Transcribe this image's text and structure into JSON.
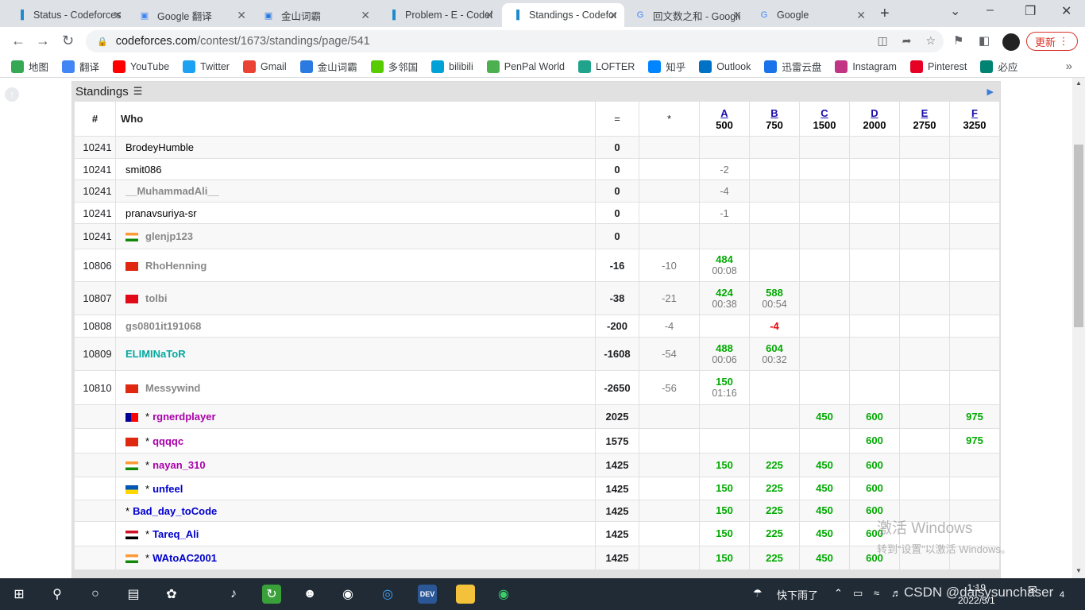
{
  "browser": {
    "tabs": [
      {
        "title": "Status - Codeforces",
        "icon": "codeforces-icon",
        "active": false
      },
      {
        "title": "Google 翻译",
        "icon": "google-translate-icon",
        "active": false
      },
      {
        "title": "金山词霸",
        "icon": "iciba-icon",
        "active": false
      },
      {
        "title": "Problem - E - Codeforces",
        "icon": "codeforces-icon",
        "active": false
      },
      {
        "title": "Standings - Codeforces",
        "icon": "codeforces-icon",
        "active": true
      },
      {
        "title": "回文数之和 - Google",
        "icon": "google-icon",
        "active": false
      },
      {
        "title": "Google",
        "icon": "google-icon",
        "active": false
      }
    ],
    "url_host": "codeforces.com",
    "url_path": "/contest/1673/standings/page/541",
    "update_label": "更新",
    "bookmarks": [
      {
        "label": "地图",
        "icon": "maps-icon",
        "color": "#34a853"
      },
      {
        "label": "翻译",
        "icon": "translate-icon",
        "color": "#4285f4"
      },
      {
        "label": "YouTube",
        "icon": "youtube-icon",
        "color": "#ff0000"
      },
      {
        "label": "Twitter",
        "icon": "twitter-icon",
        "color": "#1da1f2"
      },
      {
        "label": "Gmail",
        "icon": "gmail-icon",
        "color": "#ea4335"
      },
      {
        "label": "金山词霸",
        "icon": "iciba-icon",
        "color": "#2a7ae2"
      },
      {
        "label": "多邻国",
        "icon": "duolingo-icon",
        "color": "#58cc02"
      },
      {
        "label": "bilibili",
        "icon": "bilibili-icon",
        "color": "#00a1d6"
      },
      {
        "label": "PenPal World",
        "icon": "penpal-icon",
        "color": "#4caf50"
      },
      {
        "label": "LOFTER",
        "icon": "lofter-icon",
        "color": "#1fa38b"
      },
      {
        "label": "知乎",
        "icon": "zhihu-icon",
        "color": "#0084ff"
      },
      {
        "label": "Outlook",
        "icon": "outlook-icon",
        "color": "#0072c6"
      },
      {
        "label": "迅雷云盘",
        "icon": "xunlei-icon",
        "color": "#1a73e8"
      },
      {
        "label": "Instagram",
        "icon": "instagram-icon",
        "color": "#c13584"
      },
      {
        "label": "Pinterest",
        "icon": "pinterest-icon",
        "color": "#e60023"
      },
      {
        "label": "必应",
        "icon": "bing-icon",
        "color": "#008373"
      }
    ]
  },
  "standings": {
    "title": "Standings",
    "columns": {
      "rank": "#",
      "who": "Who",
      "score": "=",
      "penalty": "*",
      "problems": [
        {
          "letter": "A",
          "points": "500"
        },
        {
          "letter": "B",
          "points": "750"
        },
        {
          "letter": "C",
          "points": "1500"
        },
        {
          "letter": "D",
          "points": "2000"
        },
        {
          "letter": "E",
          "points": "2750"
        },
        {
          "letter": "F",
          "points": "3250"
        }
      ]
    },
    "rows": [
      {
        "rank": "10241",
        "flag": "",
        "star": "",
        "handle": "BrodeyHumble",
        "color": "black",
        "score": "0",
        "penalty": "",
        "cells": [
          [
            "",
            ""
          ],
          [
            "",
            ""
          ],
          [
            "",
            ""
          ],
          [
            "",
            ""
          ],
          [
            "",
            ""
          ],
          [
            "",
            ""
          ]
        ]
      },
      {
        "rank": "10241",
        "flag": "",
        "star": "",
        "handle": "smit086",
        "color": "black",
        "score": "0",
        "penalty": "",
        "cells": [
          [
            "-2",
            ""
          ],
          [
            "",
            ""
          ],
          [
            "",
            ""
          ],
          [
            "",
            ""
          ],
          [
            "",
            ""
          ],
          [
            "",
            ""
          ]
        ]
      },
      {
        "rank": "10241",
        "flag": "",
        "star": "",
        "handle": "__MuhammadAli__",
        "color": "gray",
        "score": "0",
        "penalty": "",
        "cells": [
          [
            "-4",
            ""
          ],
          [
            "",
            ""
          ],
          [
            "",
            ""
          ],
          [
            "",
            ""
          ],
          [
            "",
            ""
          ],
          [
            "",
            ""
          ]
        ]
      },
      {
        "rank": "10241",
        "flag": "",
        "star": "",
        "handle": "pranavsuriya-sr",
        "color": "black",
        "score": "0",
        "penalty": "",
        "cells": [
          [
            "-1",
            ""
          ],
          [
            "",
            ""
          ],
          [
            "",
            ""
          ],
          [
            "",
            ""
          ],
          [
            "",
            ""
          ],
          [
            "",
            ""
          ]
        ]
      },
      {
        "rank": "10241",
        "flag": "india",
        "star": "",
        "handle": "glenjp123",
        "color": "gray",
        "score": "0",
        "penalty": "",
        "cells": [
          [
            "",
            ""
          ],
          [
            "",
            ""
          ],
          [
            "",
            ""
          ],
          [
            "",
            ""
          ],
          [
            "",
            ""
          ],
          [
            "",
            ""
          ]
        ]
      },
      {
        "rank": "10806",
        "flag": "china",
        "star": "",
        "handle": "RhoHenning",
        "color": "gray",
        "score": "-16",
        "penalty": "-10",
        "cells": [
          [
            "484",
            "00:08"
          ],
          [
            "",
            ""
          ],
          [
            "",
            ""
          ],
          [
            "",
            ""
          ],
          [
            "",
            ""
          ],
          [
            "",
            ""
          ]
        ]
      },
      {
        "rank": "10807",
        "flag": "turkey",
        "star": "",
        "handle": "tolbi",
        "color": "gray",
        "score": "-38",
        "penalty": "-21",
        "cells": [
          [
            "424",
            "00:38"
          ],
          [
            "588",
            "00:54"
          ],
          [
            "",
            ""
          ],
          [
            "",
            ""
          ],
          [
            "",
            ""
          ],
          [
            "",
            ""
          ]
        ]
      },
      {
        "rank": "10808",
        "flag": "",
        "star": "",
        "handle": "gs0801it191068",
        "color": "gray",
        "score": "-200",
        "penalty": "-4",
        "cells": [
          [
            "",
            ""
          ],
          [
            "-4",
            ""
          ],
          [
            "",
            ""
          ],
          [
            "",
            ""
          ],
          [
            "",
            ""
          ],
          [
            "",
            ""
          ]
        ]
      },
      {
        "rank": "10809",
        "flag": "",
        "star": "",
        "handle": "ELIMINaToR",
        "color": "cyan",
        "score": "-1608",
        "penalty": "-54",
        "cells": [
          [
            "488",
            "00:06"
          ],
          [
            "604",
            "00:32"
          ],
          [
            "",
            ""
          ],
          [
            "",
            ""
          ],
          [
            "",
            ""
          ],
          [
            "",
            ""
          ]
        ]
      },
      {
        "rank": "10810",
        "flag": "china",
        "star": "",
        "handle": "Messywind",
        "color": "gray",
        "score": "-2650",
        "penalty": "-56",
        "cells": [
          [
            "150",
            "01:16"
          ],
          [
            "",
            ""
          ],
          [
            "",
            ""
          ],
          [
            "",
            ""
          ],
          [
            "",
            ""
          ],
          [
            "",
            ""
          ]
        ]
      },
      {
        "rank": "",
        "flag": "taiwan",
        "star": "*",
        "handle": "rgnerdplayer",
        "color": "purple",
        "score": "2025",
        "penalty": "",
        "cells": [
          [
            "",
            ""
          ],
          [
            "",
            ""
          ],
          [
            "450",
            ""
          ],
          [
            "600",
            ""
          ],
          [
            "",
            ""
          ],
          [
            "975",
            ""
          ]
        ]
      },
      {
        "rank": "",
        "flag": "china",
        "star": "*",
        "handle": "qqqqc",
        "color": "purple",
        "score": "1575",
        "penalty": "",
        "cells": [
          [
            "",
            ""
          ],
          [
            "",
            ""
          ],
          [
            "",
            ""
          ],
          [
            "600",
            ""
          ],
          [
            "",
            ""
          ],
          [
            "975",
            ""
          ]
        ]
      },
      {
        "rank": "",
        "flag": "india",
        "star": "*",
        "handle": "nayan_310",
        "color": "purple",
        "score": "1425",
        "penalty": "",
        "cells": [
          [
            "150",
            ""
          ],
          [
            "225",
            ""
          ],
          [
            "450",
            ""
          ],
          [
            "600",
            ""
          ],
          [
            "",
            ""
          ],
          [
            "",
            ""
          ]
        ]
      },
      {
        "rank": "",
        "flag": "ukraine",
        "star": "*",
        "handle": "unfeel",
        "color": "blue",
        "score": "1425",
        "penalty": "",
        "cells": [
          [
            "150",
            ""
          ],
          [
            "225",
            ""
          ],
          [
            "450",
            ""
          ],
          [
            "600",
            ""
          ],
          [
            "",
            ""
          ],
          [
            "",
            ""
          ]
        ]
      },
      {
        "rank": "",
        "flag": "",
        "star": "*",
        "handle": "Bad_day_toCode",
        "color": "blue",
        "score": "1425",
        "penalty": "",
        "cells": [
          [
            "150",
            ""
          ],
          [
            "225",
            ""
          ],
          [
            "450",
            ""
          ],
          [
            "600",
            ""
          ],
          [
            "",
            ""
          ],
          [
            "",
            ""
          ]
        ]
      },
      {
        "rank": "",
        "flag": "egypt",
        "star": "*",
        "handle": "Tareq_Ali",
        "color": "blue",
        "score": "1425",
        "penalty": "",
        "cells": [
          [
            "150",
            ""
          ],
          [
            "225",
            ""
          ],
          [
            "450",
            ""
          ],
          [
            "600",
            ""
          ],
          [
            "",
            ""
          ],
          [
            "",
            ""
          ]
        ]
      },
      {
        "rank": "",
        "flag": "india",
        "star": "*",
        "handle": "WAtoAC2001",
        "color": "blue",
        "score": "1425",
        "penalty": "",
        "cells": [
          [
            "150",
            ""
          ],
          [
            "225",
            ""
          ],
          [
            "450",
            ""
          ],
          [
            "600",
            ""
          ],
          [
            "",
            ""
          ],
          [
            "",
            ""
          ]
        ]
      }
    ]
  },
  "watermark": {
    "line1": "激活 Windows",
    "line2": "转到“设置”以激活 Windows。"
  },
  "taskbar": {
    "weather": "快下雨了",
    "time": "1:19",
    "date": "2022/5/1",
    "overlay": "CSDN @daisysunchaser",
    "notification_count": "4"
  }
}
